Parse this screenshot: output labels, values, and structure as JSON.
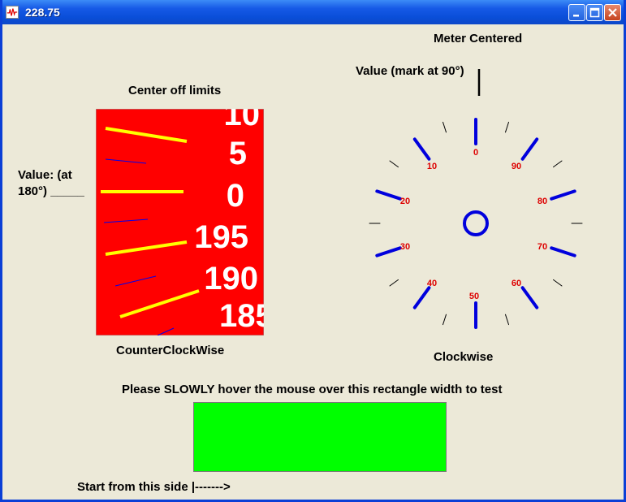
{
  "window": {
    "title": "228.75",
    "icon": "waveform-app-icon",
    "controls": [
      "minimize-icon",
      "maximize-icon",
      "close-icon"
    ]
  },
  "left_meter": {
    "heading": "Center off limits",
    "value_label_line1": "Value: (at",
    "value_label_line2": "180°) _____",
    "direction_label": "CounterClockWise",
    "background_color": "#ff0000",
    "major_tick_color": "#ffff00",
    "minor_tick_color": "#0000ff",
    "numbers": [
      "10",
      "5",
      "0",
      "195",
      "190",
      "185"
    ]
  },
  "right_meter": {
    "heading": "Meter Centered",
    "value_label": "Value (mark at 90°)",
    "direction_label": "Clockwise",
    "major_tick_color": "#0000dd",
    "number_color": "#dd0000",
    "numbers": [
      "0",
      "10",
      "20",
      "30",
      "40",
      "50",
      "60",
      "70",
      "80",
      "90"
    ]
  },
  "hover_area": {
    "instruction": "Please SLOWLY hover the mouse over this rectangle width to test",
    "start_hint": "Start from this side |------->",
    "color": "#00ff00"
  }
}
